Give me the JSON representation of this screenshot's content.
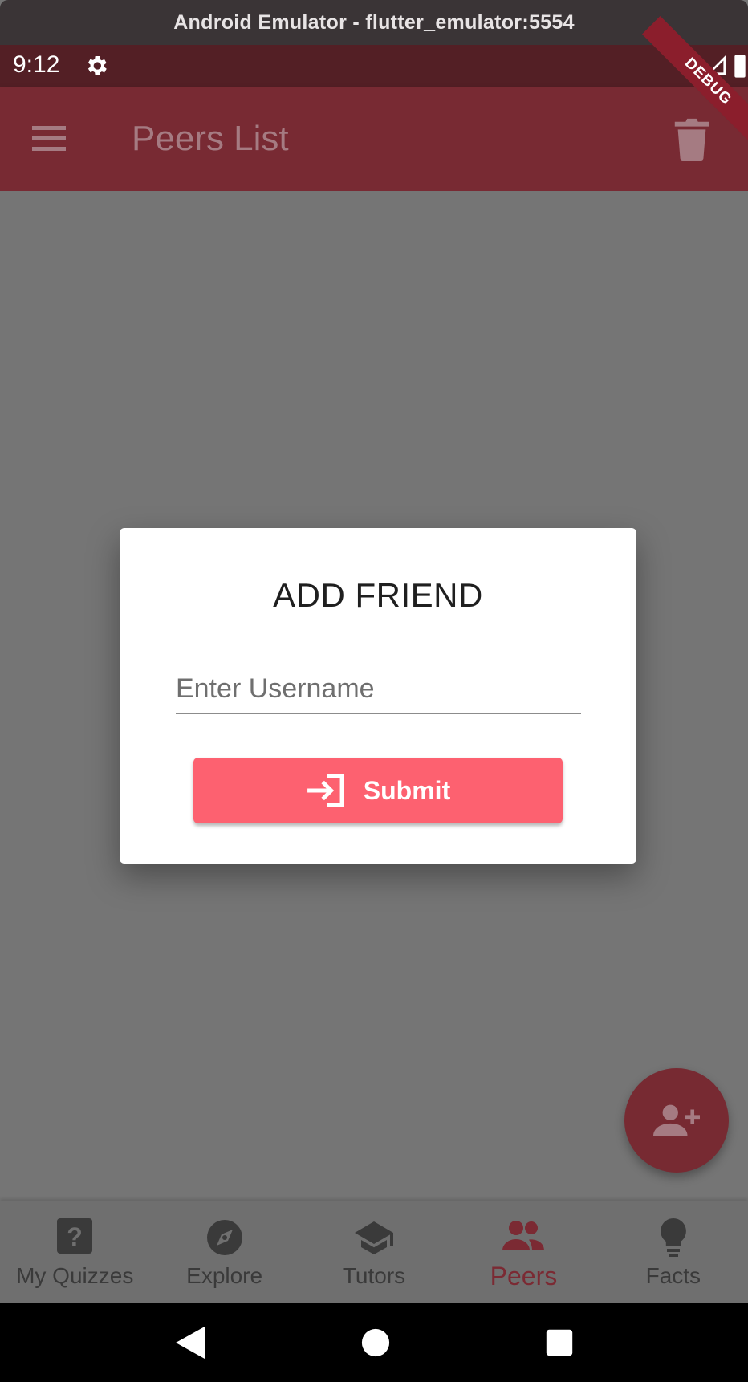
{
  "window": {
    "title": "Android Emulator - flutter_emulator:5554"
  },
  "status_bar": {
    "time": "9:12",
    "debug_label": "DEBUG"
  },
  "app_bar": {
    "title": "Peers List",
    "menu_icon": "menu-icon",
    "action_icon": "trash-icon"
  },
  "dialog": {
    "title": "ADD FRIEND",
    "username_placeholder": "Enter Username",
    "username_value": "",
    "submit_label": "Submit",
    "submit_icon": "login-icon"
  },
  "fab": {
    "icon": "person-add-icon"
  },
  "bottom_nav": {
    "items": [
      {
        "label": "My Quizzes",
        "icon": "help-icon"
      },
      {
        "label": "Explore",
        "icon": "compass-icon"
      },
      {
        "label": "Tutors",
        "icon": "school-icon"
      },
      {
        "label": "Peers",
        "icon": "people-icon",
        "active": true
      },
      {
        "label": "Facts",
        "icon": "lightbulb-icon"
      }
    ]
  },
  "colors": {
    "app_bar": "#782a33",
    "status_bar": "#531f25",
    "scrim": "#757575",
    "submit_button": "#fd6170",
    "active_nav": "#7b2a33"
  }
}
